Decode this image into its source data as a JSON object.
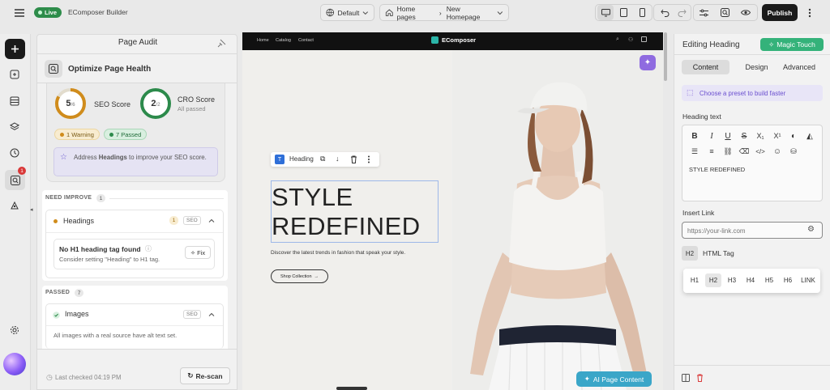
{
  "topbar": {
    "live_label": "Live",
    "app_title": "EComposer Builder",
    "device_select": "Default",
    "page_type": "Home pages",
    "page_name": "New Homepage",
    "publish_label": "Publish"
  },
  "audit": {
    "panel_title": "Page Audit",
    "section_title": "Optimize Page Health",
    "seo_score_value": "5",
    "seo_score_total": "/6",
    "seo_score_label": "SEO Score",
    "cro_score_value": "2",
    "cro_score_total": "/2",
    "cro_score_label": "CRO Score",
    "cro_status": "All passed",
    "warning_pill": "1 Warning",
    "passed_pill": "7 Passed",
    "tip_pre": "Address ",
    "tip_bold": "Headings",
    "tip_post": " to improve your SEO score.",
    "need_improve_label": "NEED IMPROVE",
    "need_improve_count": "1",
    "headings_label": "Headings",
    "headings_count": "1",
    "seo_tag": "SEO",
    "issue_title": "No H1 heading tag found",
    "issue_desc": "Consider setting \"Heading\" to H1 tag.",
    "fix_label": "Fix",
    "passed_label": "PASSED",
    "passed_count": "7",
    "images_label": "Images",
    "images_desc": "All images with a real source have alt text set.",
    "last_checked": "Last checked 04:19 PM",
    "rescan_label": "Re-scan",
    "rail_badge": "1"
  },
  "canvas": {
    "nav_links": [
      "Home",
      "Catalog",
      "Contact"
    ],
    "brand": "EComposer",
    "toolbar_label": "Heading",
    "heading_line1": "STYLE",
    "heading_line2": "REDEFINED",
    "subtitle": "Discover the latest trends in fashion that speak your style.",
    "cta_label": "Shop Collection",
    "ai_button": "AI Page Content"
  },
  "editor": {
    "title": "Editing Heading",
    "magic_button": "Magic Touch",
    "tabs": [
      "Content",
      "Design",
      "Advanced"
    ],
    "preset_label": "Choose a preset to build faster",
    "heading_text_label": "Heading text",
    "heading_text_value": "STYLE REDEFINED",
    "insert_link_label": "Insert Link",
    "link_placeholder": "https://your-link.com",
    "html_tag_badge": "H2",
    "html_tag_label": "HTML Tag",
    "tag_options": [
      "H1",
      "H2",
      "H3",
      "H4",
      "H5",
      "H6",
      "LINK"
    ]
  },
  "colors": {
    "live_green": "#2d8c4a",
    "seo_ring": "#d08c1c",
    "cro_ring": "#2c8a4b",
    "accent_purple": "#7c5cd6",
    "magic_green": "#34b27a",
    "ai_teal": "#3aa6c8"
  }
}
